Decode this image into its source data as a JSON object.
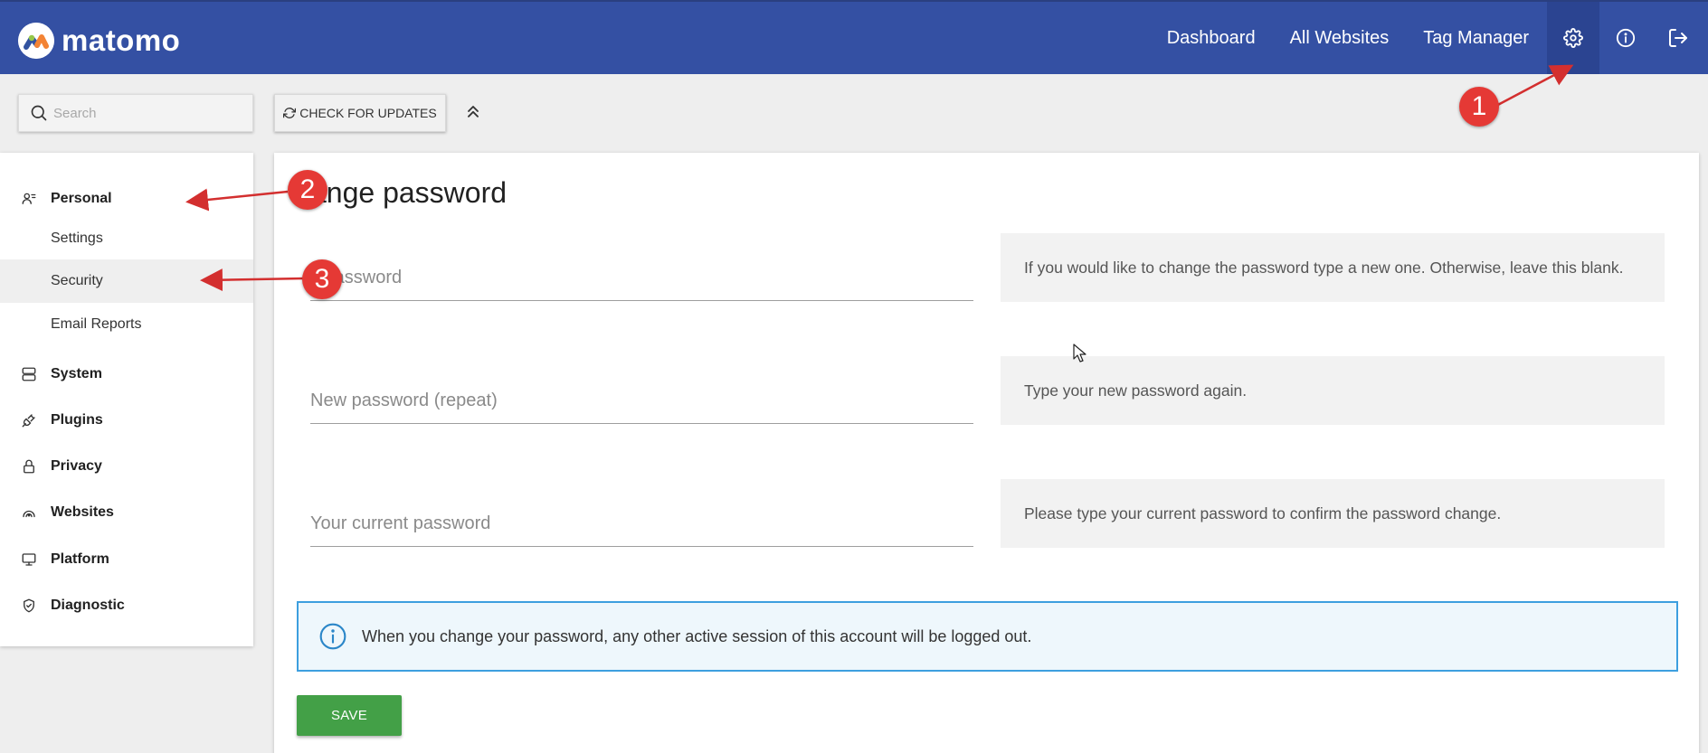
{
  "app": {
    "logo_text": "matomo",
    "brand_color": "#3450a3"
  },
  "topnav": {
    "links": [
      {
        "label": "Dashboard"
      },
      {
        "label": "All Websites"
      },
      {
        "label": "Tag Manager"
      }
    ],
    "icons": [
      "gear-icon",
      "info-icon",
      "logout-icon"
    ]
  },
  "toolbar": {
    "search_placeholder": "Search",
    "check_updates_label": "CHECK FOR UPDATES"
  },
  "sidebar": {
    "personal": {
      "label": "Personal",
      "items": [
        {
          "label": "Settings"
        },
        {
          "label": "Security",
          "active": true
        },
        {
          "label": "Email Reports"
        }
      ]
    },
    "categories": [
      {
        "label": "System",
        "icon": "server-icon"
      },
      {
        "label": "Plugins",
        "icon": "plug-icon"
      },
      {
        "label": "Privacy",
        "icon": "lock-icon"
      },
      {
        "label": "Websites",
        "icon": "websites-icon"
      },
      {
        "label": "Platform",
        "icon": "monitor-icon"
      },
      {
        "label": "Diagnostic",
        "icon": "shield-icon"
      }
    ]
  },
  "form": {
    "title": "ange password",
    "fields": [
      {
        "placeholder": "y password",
        "help": "If you would like to change the password type a new one. Otherwise, leave this blank."
      },
      {
        "placeholder": "New password (repeat)",
        "help": "Type your new password again."
      },
      {
        "placeholder": "Your current password",
        "help": "Please type your current password to confirm the password change."
      }
    ],
    "notice": "When you change your password, any other active session of this account will be logged out.",
    "save_label": "SAVE"
  },
  "annotations": {
    "badges": [
      "1",
      "2",
      "3"
    ],
    "color": "#e53935"
  }
}
